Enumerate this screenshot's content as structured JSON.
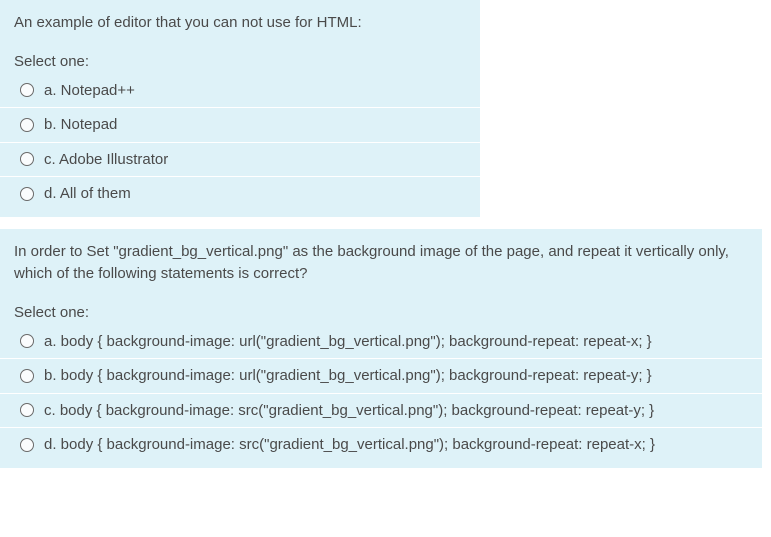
{
  "questions": [
    {
      "text": "An example of editor that you can not use for HTML:",
      "select_prompt": "Select one:",
      "options": [
        {
          "label": "a. Notepad++"
        },
        {
          "label": "b. Notepad"
        },
        {
          "label": "c. Adobe Illustrator"
        },
        {
          "label": "d. All of them"
        }
      ]
    },
    {
      "text": "In order to Set \"gradient_bg_vertical.png\" as the background image of the page, and repeat it vertically only, which of the following statements is correct?",
      "select_prompt": "Select one:",
      "options": [
        {
          "label": "a. body { background-image: url(\"gradient_bg_vertical.png\"); background-repeat: repeat-x; }"
        },
        {
          "label": "b. body { background-image: url(\"gradient_bg_vertical.png\"); background-repeat: repeat-y; }"
        },
        {
          "label": "c. body { background-image: src(\"gradient_bg_vertical.png\"); background-repeat: repeat-y; }"
        },
        {
          "label": "d. body { background-image: src(\"gradient_bg_vertical.png\"); background-repeat: repeat-x; }"
        }
      ]
    }
  ]
}
